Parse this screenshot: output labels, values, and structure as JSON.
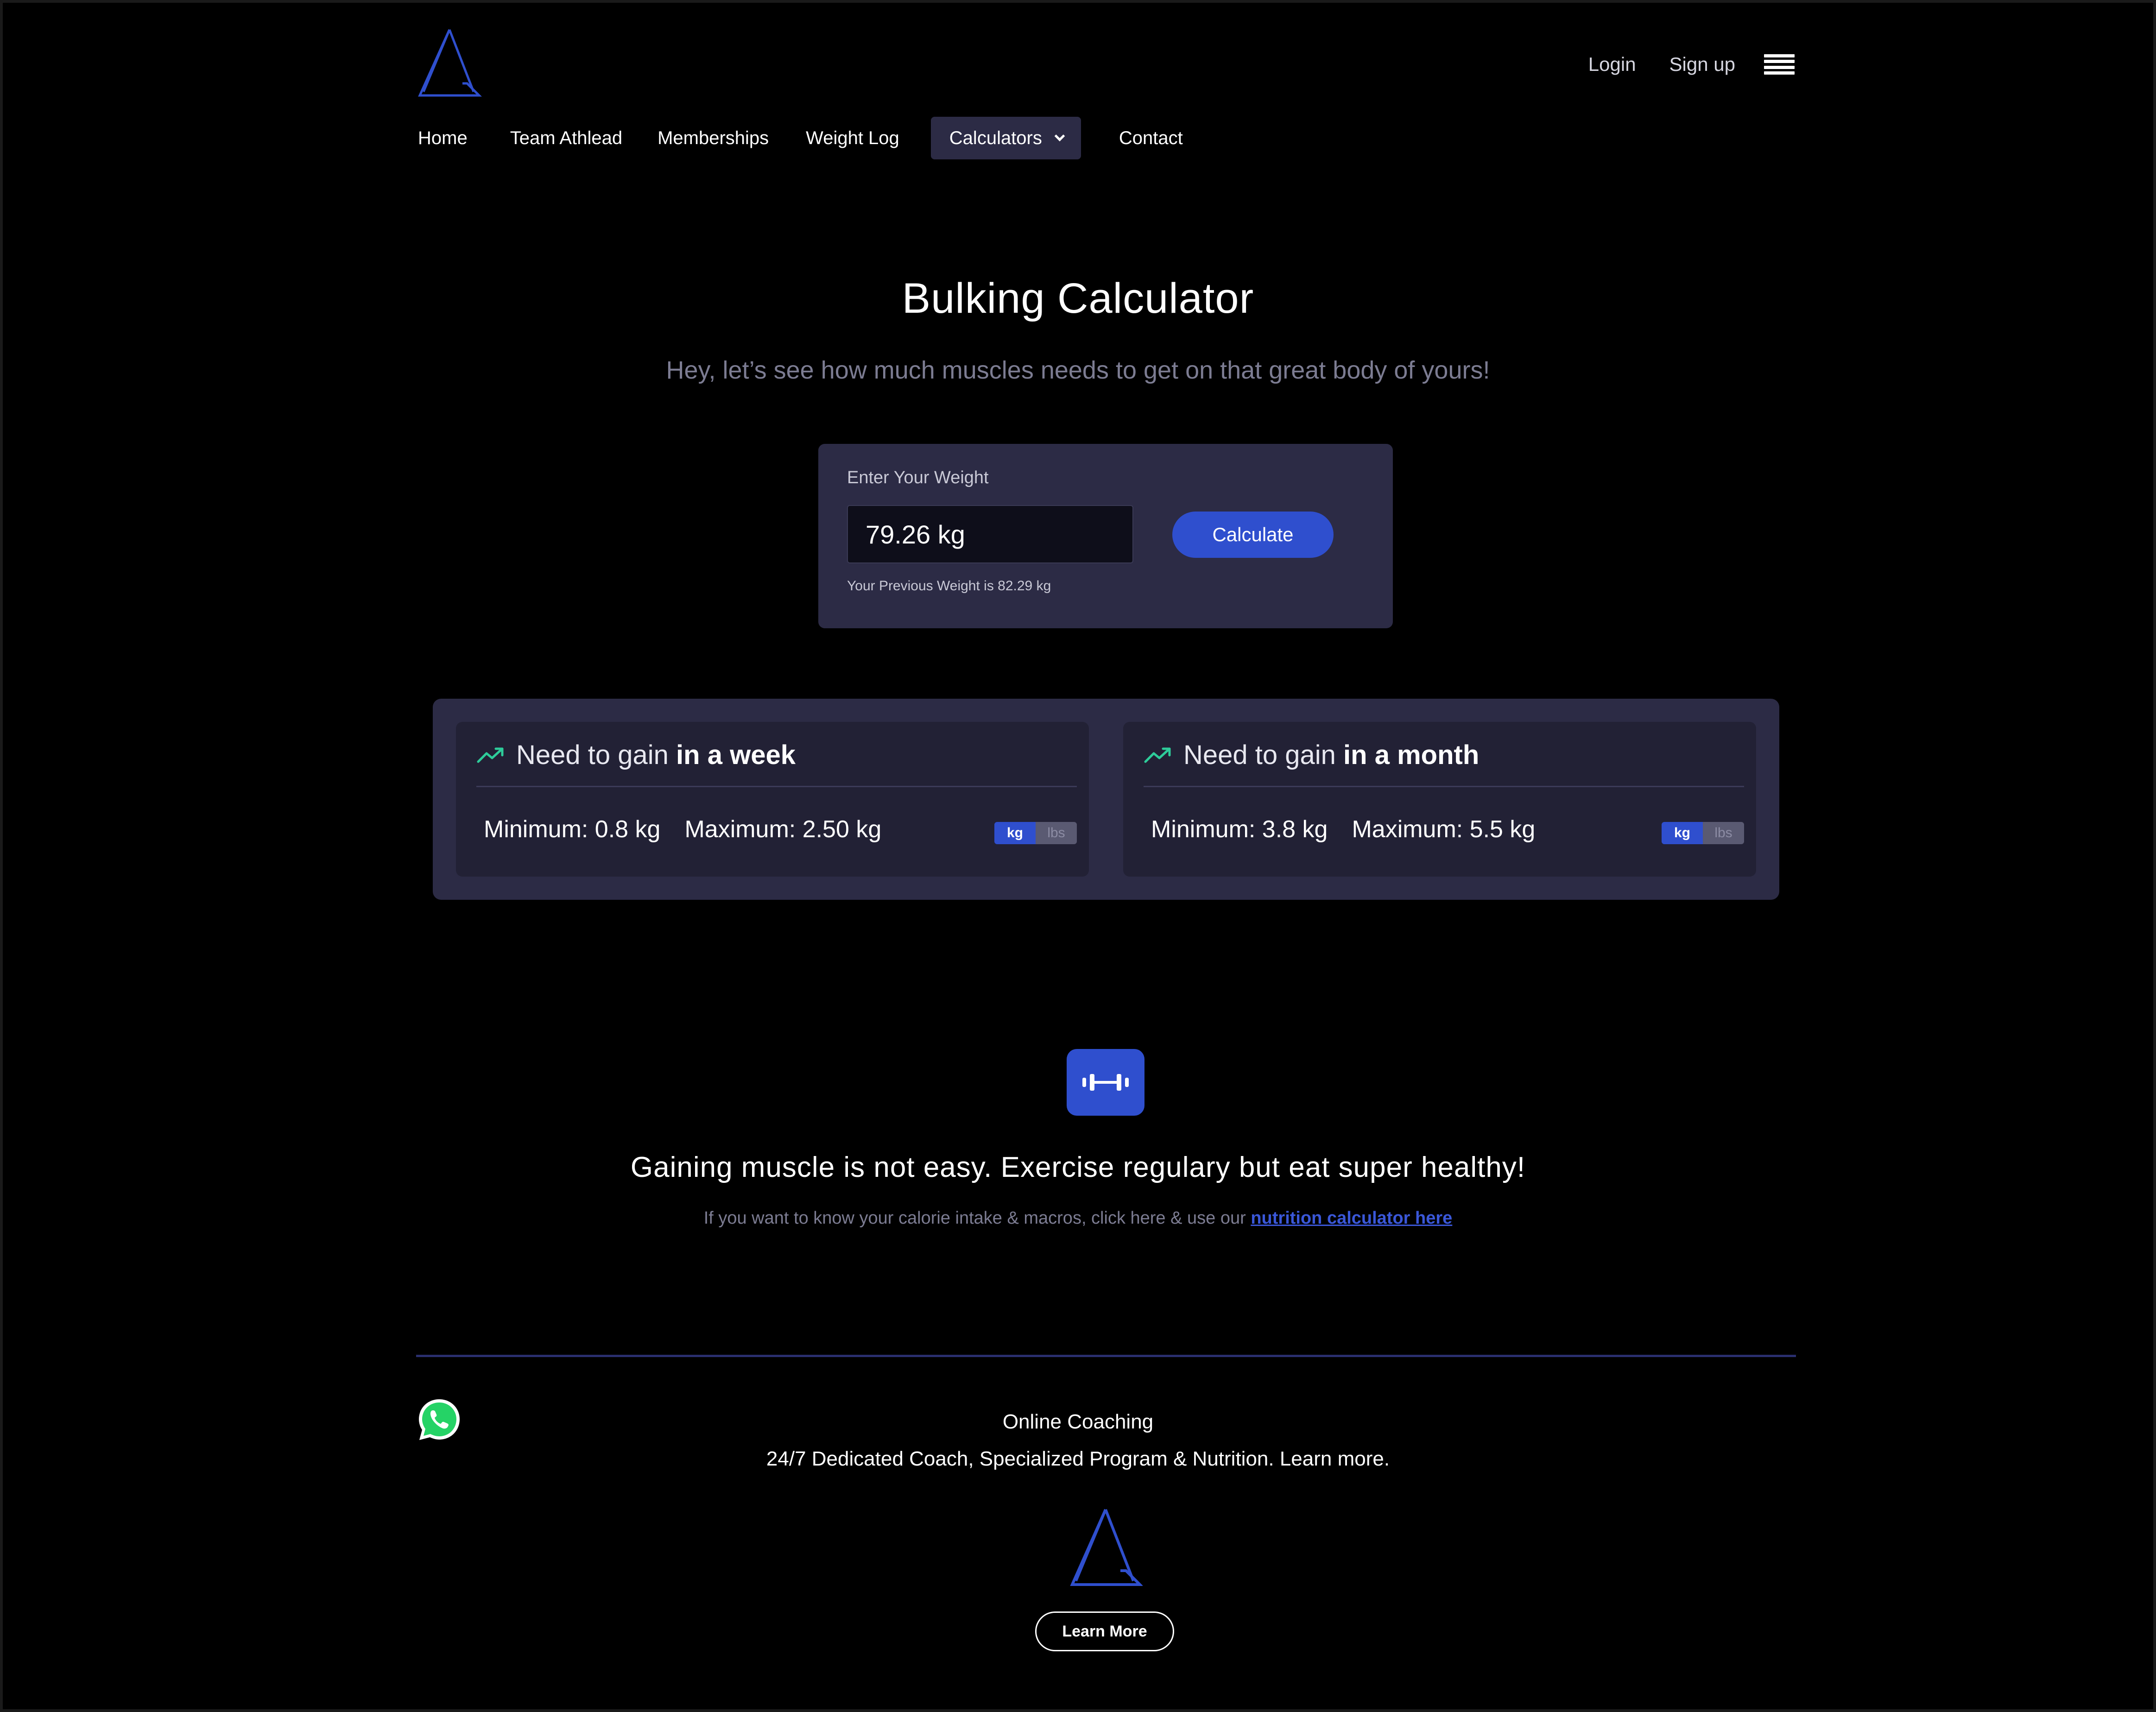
{
  "header": {
    "login": "Login",
    "signup": "Sign up"
  },
  "nav": {
    "items": [
      "Home",
      "Team Athlead",
      "Memberships",
      "Weight Log",
      "Calculators",
      "Contact"
    ],
    "active": "Calculators"
  },
  "hero": {
    "title": "Bulking Calculator",
    "subtitle": "Hey, let’s see how much muscles needs to get on that great body of yours!"
  },
  "weight_form": {
    "label": "Enter Your Weight",
    "value": "79.26 kg",
    "button": "Calculate",
    "previous": "Your Previous Weight is 82.29 kg"
  },
  "results": [
    {
      "prefix": "Need to gain",
      "period": "in a week",
      "minimum": "Minimum: 0.8 kg",
      "maximum": "Maximum: 2.50 kg",
      "unit_on": "kg",
      "unit_off": "lbs"
    },
    {
      "prefix": "Need to gain",
      "period": "in a month",
      "minimum": "Minimum: 3.8 kg",
      "maximum": "Maximum: 5.5 kg",
      "unit_on": "kg",
      "unit_off": "lbs"
    }
  ],
  "tip": {
    "icon": "dumbbell-icon",
    "title": "Gaining muscle is not easy. Exercise regulary but eat super healthy!",
    "text": "If you want to know your calorie intake & macros, click here & use our ",
    "link": "nutrition calculator here"
  },
  "footer": {
    "title": "Online Coaching",
    "subtitle": "24/7 Dedicated Coach, Specialized Program & Nutrition. Learn more.",
    "button": "Learn More"
  },
  "colors": {
    "accent": "#2f4fce",
    "card": "#2c2b45",
    "inner_card": "#222135",
    "trend": "#2ecc9a",
    "whatsapp": "#25d366"
  }
}
